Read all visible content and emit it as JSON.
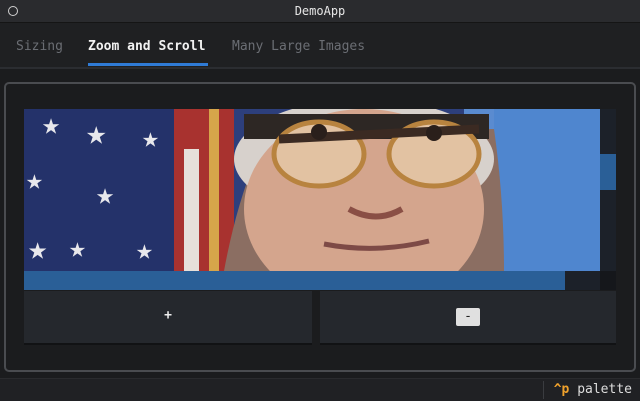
{
  "window": {
    "title": "DemoApp"
  },
  "tabs": [
    {
      "label": "Sizing",
      "active": false
    },
    {
      "label": "Zoom and Scroll",
      "active": true
    },
    {
      "label": "Many Large Images",
      "active": false
    }
  ],
  "viewer": {
    "image_subject": "portrait-photo",
    "hscroll_fraction": 0.94,
    "vscroll_position_fraction": 0.28
  },
  "buttons": {
    "zoom_in_label": "+",
    "zoom_out_label": "-"
  },
  "status": {
    "shortcut": "^p",
    "label": "palette"
  },
  "colors": {
    "accent": "#2f7bd6",
    "scroll_thumb": "#2a5f97",
    "shortcut": "#f0a22c"
  }
}
